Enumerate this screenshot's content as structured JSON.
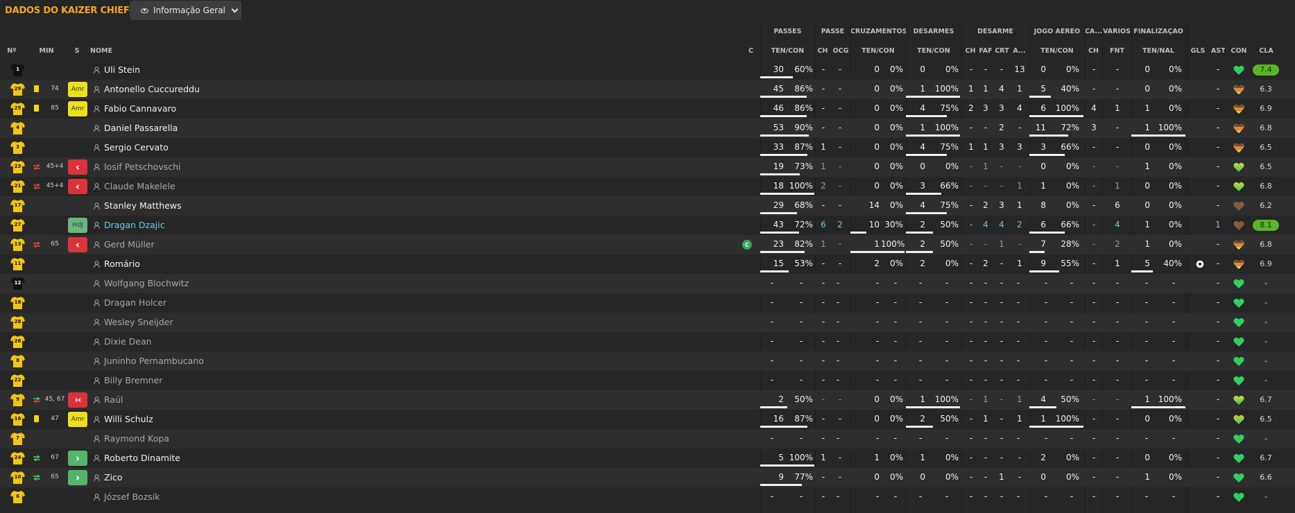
{
  "header": {
    "team_title": "DADOS DO KAIZER CHIEFS",
    "view_select": "Informação Geral"
  },
  "column_groups": [
    "PASSES",
    "PASSE",
    "CRUZAMENTOS",
    "DESARMES",
    "DESARME",
    "JOGO AÉREO",
    "CA...",
    "VÁRIOS",
    "FINALIZAÇÃO"
  ],
  "column_heads": [
    "Nº",
    "MIN",
    "S",
    "NOME",
    "C",
    "TEN/CON",
    "CH",
    "OCG",
    "TEN/CON",
    "TEN/CON",
    "CH",
    "FAF",
    "CRT",
    "A...",
    "TEN/CON",
    "CH",
    "FNT",
    "TEN/NAL",
    "GLS",
    "AST",
    "CON",
    "CLA"
  ],
  "colors": {
    "accent": "#f5a623",
    "yellow_card": "#f5d800",
    "amr": "#ece11c",
    "hdj": "#6ab580",
    "sub_out": "#d9343a",
    "sub_in": "#54b56a",
    "highlight": "#6ec8e6",
    "top_rating": "#5ab528"
  },
  "players": [
    {
      "num": "1",
      "kit": "gk",
      "card": false,
      "sub": "",
      "minute": "",
      "status": "",
      "status_label": "",
      "name": "Uli Stein",
      "style": "",
      "captain": false,
      "pass": [
        "30",
        "60%"
      ],
      "pass_bar": 0.6,
      "pch": "-",
      "pocg": "-",
      "cross": [
        "0",
        "0%"
      ],
      "cross_bar": 0,
      "tack": [
        "0",
        "0%"
      ],
      "tack_bar": 0,
      "dch": "-",
      "dfaf": "-",
      "dcrt": "-",
      "da": "13",
      "air": [
        "0",
        "0%"
      ],
      "air_bar": 0,
      "ca": "-",
      "fnt": "-",
      "shot": [
        "0",
        "0%"
      ],
      "shot_bar": 0,
      "goal_icon": false,
      "ast": "-",
      "con": "green",
      "rating": "7.4",
      "top": true,
      "dim": false
    },
    {
      "num": "29",
      "kit": "y",
      "card": true,
      "sub": "",
      "minute": "74",
      "status": "amr",
      "status_label": "Amr",
      "name": "Antonello Cuccureddu",
      "style": "",
      "captain": false,
      "pass": [
        "45",
        "86%"
      ],
      "pass_bar": 0.86,
      "pch": "-",
      "pocg": "-",
      "cross": [
        "0",
        "0%"
      ],
      "cross_bar": 0,
      "tack": [
        "1",
        "100%"
      ],
      "tack_bar": 1,
      "dch": "1",
      "dfaf": "1",
      "dcrt": "4",
      "da": "1",
      "air": [
        "5",
        "40%"
      ],
      "air_bar": 0.4,
      "ca": "-",
      "fnt": "-",
      "shot": [
        "0",
        "0%"
      ],
      "shot_bar": 0,
      "goal_icon": false,
      "ast": "-",
      "con": "morale",
      "rating": "6.3",
      "top": false,
      "dim": false
    },
    {
      "num": "25",
      "kit": "y",
      "card": true,
      "sub": "",
      "minute": "85",
      "status": "amr",
      "status_label": "Amr",
      "name": "Fabio Cannavaro",
      "style": "",
      "captain": false,
      "pass": [
        "46",
        "86%"
      ],
      "pass_bar": 0.86,
      "pch": "-",
      "pocg": "-",
      "cross": [
        "0",
        "0%"
      ],
      "cross_bar": 0,
      "tack": [
        "4",
        "75%"
      ],
      "tack_bar": 0.75,
      "dch": "2",
      "dfaf": "3",
      "dcrt": "3",
      "da": "4",
      "air": [
        "6",
        "100%"
      ],
      "air_bar": 1,
      "ca": "4",
      "fnt": "1",
      "shot": [
        "1",
        "0%"
      ],
      "shot_bar": 0,
      "goal_icon": false,
      "ast": "-",
      "con": "morale",
      "rating": "6.9",
      "top": false,
      "dim": false
    },
    {
      "num": "4",
      "kit": "y",
      "card": false,
      "sub": "",
      "minute": "",
      "status": "",
      "status_label": "",
      "name": "Daniel Passarella",
      "style": "",
      "captain": false,
      "pass": [
        "53",
        "90%"
      ],
      "pass_bar": 0.9,
      "pch": "-",
      "pocg": "-",
      "cross": [
        "0",
        "0%"
      ],
      "cross_bar": 0,
      "tack": [
        "1",
        "100%"
      ],
      "tack_bar": 1,
      "dch": "-",
      "dfaf": "-",
      "dcrt": "2",
      "da": "-",
      "air": [
        "11",
        "72%"
      ],
      "air_bar": 0.72,
      "ca": "3",
      "fnt": "-",
      "shot": [
        "1",
        "100%"
      ],
      "shot_bar": 1,
      "goal_icon": false,
      "ast": "-",
      "con": "morale",
      "rating": "6.8",
      "top": false,
      "dim": false
    },
    {
      "num": "3",
      "kit": "y",
      "card": false,
      "sub": "",
      "minute": "",
      "status": "",
      "status_label": "",
      "name": "Sergio Cervato",
      "style": "",
      "captain": false,
      "pass": [
        "33",
        "87%"
      ],
      "pass_bar": 0.87,
      "pch": "1",
      "pocg": "-",
      "cross": [
        "0",
        "0%"
      ],
      "cross_bar": 0,
      "tack": [
        "4",
        "75%"
      ],
      "tack_bar": 0.75,
      "dch": "1",
      "dfaf": "1",
      "dcrt": "3",
      "da": "3",
      "air": [
        "3",
        "66%"
      ],
      "air_bar": 0.66,
      "ca": "-",
      "fnt": "-",
      "shot": [
        "0",
        "0%"
      ],
      "shot_bar": 0,
      "goal_icon": false,
      "ast": "-",
      "con": "morale",
      "rating": "6.5",
      "top": false,
      "dim": false
    },
    {
      "num": "23",
      "kit": "y",
      "card": false,
      "sub": "swap",
      "minute": "45+4",
      "status": "out",
      "status_label": "‹",
      "name": "Iosif Petschovschi",
      "style": "sub",
      "captain": false,
      "pass": [
        "19",
        "73%"
      ],
      "pass_bar": 0.73,
      "pch": "1",
      "pocg": "-",
      "cross": [
        "0",
        "0%"
      ],
      "cross_bar": 0,
      "tack": [
        "0",
        "0%"
      ],
      "tack_bar": 0,
      "dch": "-",
      "dfaf": "1",
      "dcrt": "-",
      "da": "-",
      "air": [
        "0",
        "0%"
      ],
      "air_bar": 0,
      "ca": "-",
      "fnt": "-",
      "shot": [
        "1",
        "0%"
      ],
      "shot_bar": 0,
      "goal_icon": false,
      "ast": "-",
      "con": "yellowgreen",
      "rating": "6.5",
      "top": false,
      "dim": true
    },
    {
      "num": "21",
      "kit": "y",
      "card": false,
      "sub": "swap",
      "minute": "45+4",
      "status": "out",
      "status_label": "‹",
      "name": "Claude Makelele",
      "style": "sub",
      "captain": false,
      "pass": [
        "18",
        "100%"
      ],
      "pass_bar": 1,
      "pch": "2",
      "pocg": "-",
      "cross": [
        "0",
        "0%"
      ],
      "cross_bar": 0,
      "tack": [
        "3",
        "66%"
      ],
      "tack_bar": 0.66,
      "dch": "-",
      "dfaf": "-",
      "dcrt": "-",
      "da": "1",
      "air": [
        "1",
        "0%"
      ],
      "air_bar": 0,
      "ca": "-",
      "fnt": "1",
      "shot": [
        "0",
        "0%"
      ],
      "shot_bar": 0,
      "goal_icon": false,
      "ast": "-",
      "con": "yellowgreen",
      "rating": "6.8",
      "top": false,
      "dim": true
    },
    {
      "num": "17",
      "kit": "y",
      "card": false,
      "sub": "",
      "minute": "",
      "status": "",
      "status_label": "",
      "name": "Stanley Matthews",
      "style": "",
      "captain": false,
      "pass": [
        "29",
        "68%"
      ],
      "pass_bar": 0.68,
      "pch": "-",
      "pocg": "-",
      "cross": [
        "14",
        "0%"
      ],
      "cross_bar": 0,
      "tack": [
        "4",
        "75%"
      ],
      "tack_bar": 0.75,
      "dch": "-",
      "dfaf": "2",
      "dcrt": "3",
      "da": "1",
      "air": [
        "8",
        "0%"
      ],
      "air_bar": 0,
      "ca": "-",
      "fnt": "6",
      "shot": [
        "0",
        "0%"
      ],
      "shot_bar": 0,
      "goal_icon": false,
      "ast": "-",
      "con": "brown",
      "rating": "6.2",
      "top": false,
      "dim": false
    },
    {
      "num": "27",
      "kit": "y",
      "card": false,
      "sub": "",
      "minute": "",
      "status": "hdj",
      "status_label": "HdJ",
      "name": "Dragan Dzajic",
      "style": "star",
      "captain": false,
      "pass": [
        "43",
        "72%"
      ],
      "pass_bar": 0.72,
      "pch": "6",
      "pocg": "2",
      "cross": [
        "10",
        "30%"
      ],
      "cross_bar": 0.3,
      "tack": [
        "2",
        "50%"
      ],
      "tack_bar": 0.5,
      "dch": "-",
      "dfaf": "4",
      "dcrt": "4",
      "da": "2",
      "air": [
        "6",
        "66%"
      ],
      "air_bar": 0.66,
      "ca": "-",
      "fnt": "4",
      "shot": [
        "1",
        "0%"
      ],
      "shot_bar": 0,
      "goal_icon": false,
      "ast": "1",
      "con": "brown",
      "rating": "8.1",
      "top": true,
      "dim": false
    },
    {
      "num": "13",
      "kit": "y",
      "card": false,
      "sub": "swap",
      "minute": "65",
      "status": "out",
      "status_label": "‹",
      "name": "Gerd Müller",
      "style": "sub",
      "captain": true,
      "pass": [
        "23",
        "82%"
      ],
      "pass_bar": 0.82,
      "pch": "1",
      "pocg": "-",
      "cross": [
        "1",
        "100%"
      ],
      "cross_bar": 1,
      "tack": [
        "2",
        "50%"
      ],
      "tack_bar": 0.5,
      "dch": "-",
      "dfaf": "-",
      "dcrt": "1",
      "da": "-",
      "air": [
        "7",
        "28%"
      ],
      "air_bar": 0.28,
      "ca": "-",
      "fnt": "2",
      "shot": [
        "1",
        "0%"
      ],
      "shot_bar": 0,
      "goal_icon": false,
      "ast": "-",
      "con": "morale",
      "rating": "6.8",
      "top": false,
      "dim": true
    },
    {
      "num": "11",
      "kit": "y",
      "card": false,
      "sub": "",
      "minute": "",
      "status": "",
      "status_label": "",
      "name": "Romário",
      "style": "",
      "captain": false,
      "pass": [
        "15",
        "53%"
      ],
      "pass_bar": 0.53,
      "pch": "-",
      "pocg": "-",
      "cross": [
        "2",
        "0%"
      ],
      "cross_bar": 0,
      "tack": [
        "2",
        "0%"
      ],
      "tack_bar": 0,
      "dch": "-",
      "dfaf": "2",
      "dcrt": "-",
      "da": "1",
      "air": [
        "9",
        "55%"
      ],
      "air_bar": 0.55,
      "ca": "-",
      "fnt": "1",
      "shot": [
        "5",
        "40%"
      ],
      "shot_bar": 0.4,
      "goal_icon": true,
      "ast": "-",
      "con": "morale",
      "rating": "6.9",
      "top": false,
      "dim": false
    },
    {
      "num": "12",
      "kit": "gk",
      "card": false,
      "sub": "",
      "minute": "",
      "status": "",
      "status_label": "",
      "name": "Wolfgang Blochwitz",
      "style": "sub",
      "captain": false,
      "empty": true,
      "con": "green",
      "rating": "-"
    },
    {
      "num": "18",
      "kit": "y",
      "card": false,
      "sub": "",
      "minute": "",
      "status": "",
      "status_label": "",
      "name": "Dragan Holcer",
      "style": "sub",
      "captain": false,
      "empty": true,
      "con": "green",
      "rating": "-"
    },
    {
      "num": "28",
      "kit": "y",
      "card": false,
      "sub": "",
      "minute": "",
      "status": "",
      "status_label": "",
      "name": "Wesley Sneijder",
      "style": "sub",
      "captain": false,
      "empty": true,
      "con": "green",
      "rating": "-"
    },
    {
      "num": "26",
      "kit": "y",
      "card": false,
      "sub": "",
      "minute": "",
      "status": "",
      "status_label": "",
      "name": "Dixie Dean",
      "style": "sub",
      "captain": false,
      "empty": true,
      "con": "green",
      "rating": "-"
    },
    {
      "num": "8",
      "kit": "y",
      "card": false,
      "sub": "",
      "minute": "",
      "status": "",
      "status_label": "",
      "name": "Juninho Pernambucano",
      "style": "sub",
      "captain": false,
      "empty": true,
      "con": "green",
      "rating": "-"
    },
    {
      "num": "22",
      "kit": "y",
      "card": false,
      "sub": "",
      "minute": "",
      "status": "",
      "status_label": "",
      "name": "Billy Bremner",
      "style": "sub",
      "captain": false,
      "empty": true,
      "con": "green",
      "rating": "-"
    },
    {
      "num": "9",
      "kit": "y",
      "card": false,
      "sub": "swap2",
      "minute": "45, 67",
      "status": "inout",
      "status_label": "›‹",
      "name": "Raúl",
      "style": "sub",
      "captain": false,
      "pass": [
        "2",
        "50%"
      ],
      "pass_bar": 0.5,
      "pch": "-",
      "pocg": "-",
      "cross": [
        "0",
        "0%"
      ],
      "cross_bar": 0,
      "tack": [
        "1",
        "100%"
      ],
      "tack_bar": 1,
      "dch": "-",
      "dfaf": "1",
      "dcrt": "-",
      "da": "1",
      "air": [
        "4",
        "50%"
      ],
      "air_bar": 0.5,
      "ca": "-",
      "fnt": "-",
      "shot": [
        "1",
        "100%"
      ],
      "shot_bar": 1,
      "goal_icon": false,
      "ast": "-",
      "con": "yellowgreen",
      "rating": "6.7",
      "top": false,
      "dim": true
    },
    {
      "num": "16",
      "kit": "y",
      "card": true,
      "sub": "",
      "minute": "47",
      "status": "amr",
      "status_label": "Amr",
      "name": "Willi Schulz",
      "style": "",
      "captain": false,
      "pass": [
        "16",
        "87%"
      ],
      "pass_bar": 0.87,
      "pch": "-",
      "pocg": "-",
      "cross": [
        "0",
        "0%"
      ],
      "cross_bar": 0,
      "tack": [
        "2",
        "50%"
      ],
      "tack_bar": 0.5,
      "dch": "-",
      "dfaf": "1",
      "dcrt": "-",
      "da": "1",
      "air": [
        "1",
        "100%"
      ],
      "air_bar": 1,
      "ca": "-",
      "fnt": "-",
      "shot": [
        "0",
        "0%"
      ],
      "shot_bar": 0,
      "goal_icon": false,
      "ast": "-",
      "con": "yellowgreen",
      "rating": "6.5",
      "top": false,
      "dim": false
    },
    {
      "num": "7",
      "kit": "y",
      "card": false,
      "sub": "",
      "minute": "",
      "status": "",
      "status_label": "",
      "name": "Raymond Kopa",
      "style": "sub",
      "captain": false,
      "empty": true,
      "con": "green",
      "rating": "-"
    },
    {
      "num": "24",
      "kit": "y",
      "card": false,
      "sub": "in",
      "minute": "67",
      "status": "in",
      "status_label": "›",
      "name": "Roberto Dinamite",
      "style": "",
      "captain": false,
      "pass": [
        "5",
        "100%"
      ],
      "pass_bar": 1,
      "pch": "1",
      "pocg": "-",
      "cross": [
        "1",
        "0%"
      ],
      "cross_bar": 0,
      "tack": [
        "1",
        "0%"
      ],
      "tack_bar": 0,
      "dch": "-",
      "dfaf": "-",
      "dcrt": "-",
      "da": "-",
      "air": [
        "2",
        "0%"
      ],
      "air_bar": 0,
      "ca": "-",
      "fnt": "-",
      "shot": [
        "0",
        "0%"
      ],
      "shot_bar": 0,
      "goal_icon": false,
      "ast": "-",
      "con": "green",
      "rating": "6.7",
      "top": false,
      "dim": false
    },
    {
      "num": "10",
      "kit": "y",
      "card": false,
      "sub": "in",
      "minute": "65",
      "status": "in",
      "status_label": "›",
      "name": "Zico",
      "style": "",
      "captain": false,
      "pass": [
        "9",
        "77%"
      ],
      "pass_bar": 0.77,
      "pch": "-",
      "pocg": "-",
      "cross": [
        "0",
        "0%"
      ],
      "cross_bar": 0,
      "tack": [
        "0",
        "0%"
      ],
      "tack_bar": 0,
      "dch": "-",
      "dfaf": "-",
      "dcrt": "1",
      "da": "-",
      "air": [
        "0",
        "0%"
      ],
      "air_bar": 0,
      "ca": "-",
      "fnt": "-",
      "shot": [
        "1",
        "0%"
      ],
      "shot_bar": 0,
      "goal_icon": false,
      "ast": "-",
      "con": "green",
      "rating": "6.6",
      "top": false,
      "dim": false
    },
    {
      "num": "6",
      "kit": "y",
      "card": false,
      "sub": "",
      "minute": "",
      "status": "",
      "status_label": "",
      "name": "József Bozsik",
      "style": "sub",
      "captain": false,
      "empty": true,
      "con": "green",
      "rating": "-"
    }
  ]
}
